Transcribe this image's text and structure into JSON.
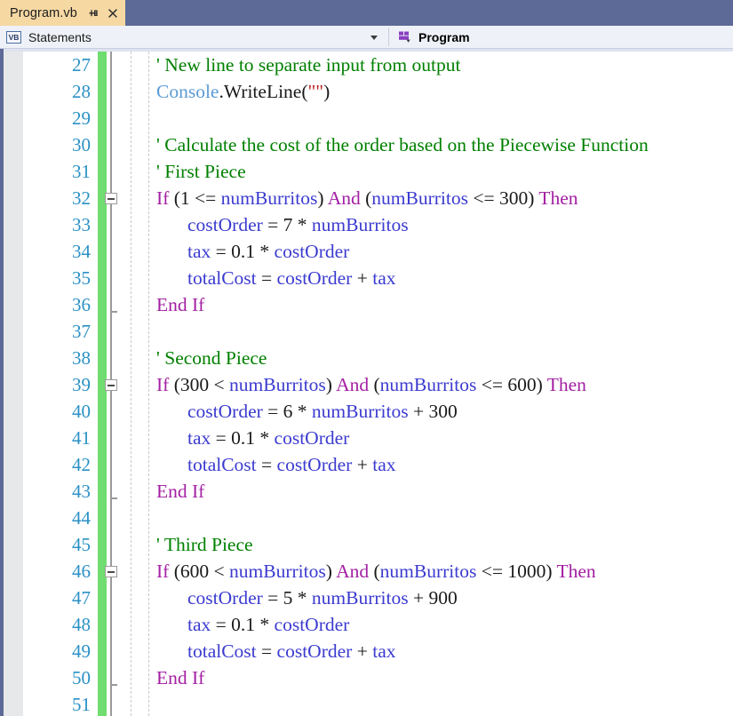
{
  "window": {
    "tab": {
      "title": "Program.vb",
      "pin_icon": "pin-icon",
      "close_icon": "close-icon"
    },
    "navbar": {
      "left": {
        "icon": "vb-file-icon",
        "icon_label": "VB",
        "value": "Statements",
        "caret_icon": "chevron-down-icon"
      },
      "right": {
        "icon": "vb-module-icon",
        "value": "Program"
      }
    }
  },
  "colors": {
    "tab_active_bg": "#f6d8a3",
    "titlebar_bg": "#5d6a97",
    "navbar_bg": "#eff1f8",
    "editor_bg": "#ffffff",
    "line_number": "#2b91c6",
    "change_bar": "#70dd70",
    "keyword": "#a31fa3",
    "comment": "#008000",
    "identifier": "#3b3bd0",
    "class_name": "#5b9bd5",
    "string": "#bb2222",
    "gutter": "#e7e8ea"
  },
  "editor": {
    "language": "VB.NET",
    "first_visible_line": 27,
    "last_visible_line": 51,
    "lines": [
      {
        "number": 27,
        "fold": "none",
        "indent": 0,
        "tokens": [
          {
            "t": "' New line to separate input from output",
            "c": "cmt"
          }
        ]
      },
      {
        "number": 28,
        "fold": "none",
        "indent": 0,
        "tokens": [
          {
            "t": "Console",
            "c": "cls"
          },
          {
            "t": ".WriteLine(",
            "c": "plain"
          },
          {
            "t": "\"\"",
            "c": "str"
          },
          {
            "t": ")",
            "c": "plain"
          }
        ]
      },
      {
        "number": 29,
        "fold": "none",
        "indent": 0,
        "tokens": []
      },
      {
        "number": 30,
        "fold": "none",
        "indent": 0,
        "tokens": [
          {
            "t": "' Calculate the cost of the order based on the Piecewise Function",
            "c": "cmt"
          }
        ]
      },
      {
        "number": 31,
        "fold": "none",
        "indent": 0,
        "tokens": [
          {
            "t": "' First Piece",
            "c": "cmt"
          }
        ]
      },
      {
        "number": 32,
        "fold": "collapse",
        "indent": 0,
        "tokens": [
          {
            "t": "If ",
            "c": "kw"
          },
          {
            "t": "(1 <= ",
            "c": "plain"
          },
          {
            "t": "numBurritos",
            "c": "id"
          },
          {
            "t": ") ",
            "c": "plain"
          },
          {
            "t": "And",
            "c": "kw"
          },
          {
            "t": " (",
            "c": "plain"
          },
          {
            "t": "numBurritos",
            "c": "id"
          },
          {
            "t": " <= 300) ",
            "c": "plain"
          },
          {
            "t": "Then",
            "c": "kw"
          }
        ]
      },
      {
        "number": 33,
        "fold": "none",
        "indent": 1,
        "tokens": [
          {
            "t": "costOrder",
            "c": "id"
          },
          {
            "t": " = 7 * ",
            "c": "plain"
          },
          {
            "t": "numBurritos",
            "c": "id"
          }
        ]
      },
      {
        "number": 34,
        "fold": "none",
        "indent": 1,
        "tokens": [
          {
            "t": "tax",
            "c": "id"
          },
          {
            "t": " = 0.1 * ",
            "c": "plain"
          },
          {
            "t": "costOrder",
            "c": "id"
          }
        ]
      },
      {
        "number": 35,
        "fold": "none",
        "indent": 1,
        "tokens": [
          {
            "t": "totalCost",
            "c": "id"
          },
          {
            "t": " = ",
            "c": "plain"
          },
          {
            "t": "costOrder",
            "c": "id"
          },
          {
            "t": " + ",
            "c": "plain"
          },
          {
            "t": "tax",
            "c": "id"
          }
        ]
      },
      {
        "number": 36,
        "fold": "end",
        "indent": 0,
        "tokens": [
          {
            "t": "End If",
            "c": "kw"
          }
        ]
      },
      {
        "number": 37,
        "fold": "none",
        "indent": 0,
        "tokens": []
      },
      {
        "number": 38,
        "fold": "none",
        "indent": 0,
        "tokens": [
          {
            "t": "' Second Piece",
            "c": "cmt"
          }
        ]
      },
      {
        "number": 39,
        "fold": "collapse",
        "indent": 0,
        "tokens": [
          {
            "t": "If ",
            "c": "kw"
          },
          {
            "t": "(300 < ",
            "c": "plain"
          },
          {
            "t": "numBurritos",
            "c": "id"
          },
          {
            "t": ") ",
            "c": "plain"
          },
          {
            "t": "And",
            "c": "kw"
          },
          {
            "t": " (",
            "c": "plain"
          },
          {
            "t": "numBurritos",
            "c": "id"
          },
          {
            "t": " <= 600) ",
            "c": "plain"
          },
          {
            "t": "Then",
            "c": "kw"
          }
        ]
      },
      {
        "number": 40,
        "fold": "none",
        "indent": 1,
        "tokens": [
          {
            "t": "costOrder",
            "c": "id"
          },
          {
            "t": " = 6 * ",
            "c": "plain"
          },
          {
            "t": "numBurritos",
            "c": "id"
          },
          {
            "t": " + 300",
            "c": "plain"
          }
        ]
      },
      {
        "number": 41,
        "fold": "none",
        "indent": 1,
        "tokens": [
          {
            "t": "tax",
            "c": "id"
          },
          {
            "t": " = 0.1 * ",
            "c": "plain"
          },
          {
            "t": "costOrder",
            "c": "id"
          }
        ]
      },
      {
        "number": 42,
        "fold": "none",
        "indent": 1,
        "tokens": [
          {
            "t": "totalCost",
            "c": "id"
          },
          {
            "t": " = ",
            "c": "plain"
          },
          {
            "t": "costOrder",
            "c": "id"
          },
          {
            "t": " + ",
            "c": "plain"
          },
          {
            "t": "tax",
            "c": "id"
          }
        ]
      },
      {
        "number": 43,
        "fold": "end",
        "indent": 0,
        "tokens": [
          {
            "t": "End If",
            "c": "kw"
          }
        ]
      },
      {
        "number": 44,
        "fold": "none",
        "indent": 0,
        "tokens": []
      },
      {
        "number": 45,
        "fold": "none",
        "indent": 0,
        "tokens": [
          {
            "t": "' Third Piece",
            "c": "cmt"
          }
        ]
      },
      {
        "number": 46,
        "fold": "collapse",
        "indent": 0,
        "tokens": [
          {
            "t": "If ",
            "c": "kw"
          },
          {
            "t": "(600 < ",
            "c": "plain"
          },
          {
            "t": "numBurritos",
            "c": "id"
          },
          {
            "t": ") ",
            "c": "plain"
          },
          {
            "t": "And",
            "c": "kw"
          },
          {
            "t": " (",
            "c": "plain"
          },
          {
            "t": "numBurritos",
            "c": "id"
          },
          {
            "t": " <= 1000) ",
            "c": "plain"
          },
          {
            "t": "Then",
            "c": "kw"
          }
        ]
      },
      {
        "number": 47,
        "fold": "none",
        "indent": 1,
        "tokens": [
          {
            "t": "costOrder",
            "c": "id"
          },
          {
            "t": " = 5 * ",
            "c": "plain"
          },
          {
            "t": "numBurritos",
            "c": "id"
          },
          {
            "t": " + 900",
            "c": "plain"
          }
        ]
      },
      {
        "number": 48,
        "fold": "none",
        "indent": 1,
        "tokens": [
          {
            "t": "tax",
            "c": "id"
          },
          {
            "t": " = 0.1 * ",
            "c": "plain"
          },
          {
            "t": "costOrder",
            "c": "id"
          }
        ]
      },
      {
        "number": 49,
        "fold": "none",
        "indent": 1,
        "tokens": [
          {
            "t": "totalCost",
            "c": "id"
          },
          {
            "t": " = ",
            "c": "plain"
          },
          {
            "t": "costOrder",
            "c": "id"
          },
          {
            "t": " + ",
            "c": "plain"
          },
          {
            "t": "tax",
            "c": "id"
          }
        ]
      },
      {
        "number": 50,
        "fold": "end",
        "indent": 0,
        "tokens": [
          {
            "t": "End If",
            "c": "kw"
          }
        ]
      },
      {
        "number": 51,
        "fold": "none",
        "indent": 0,
        "tokens": []
      }
    ]
  }
}
